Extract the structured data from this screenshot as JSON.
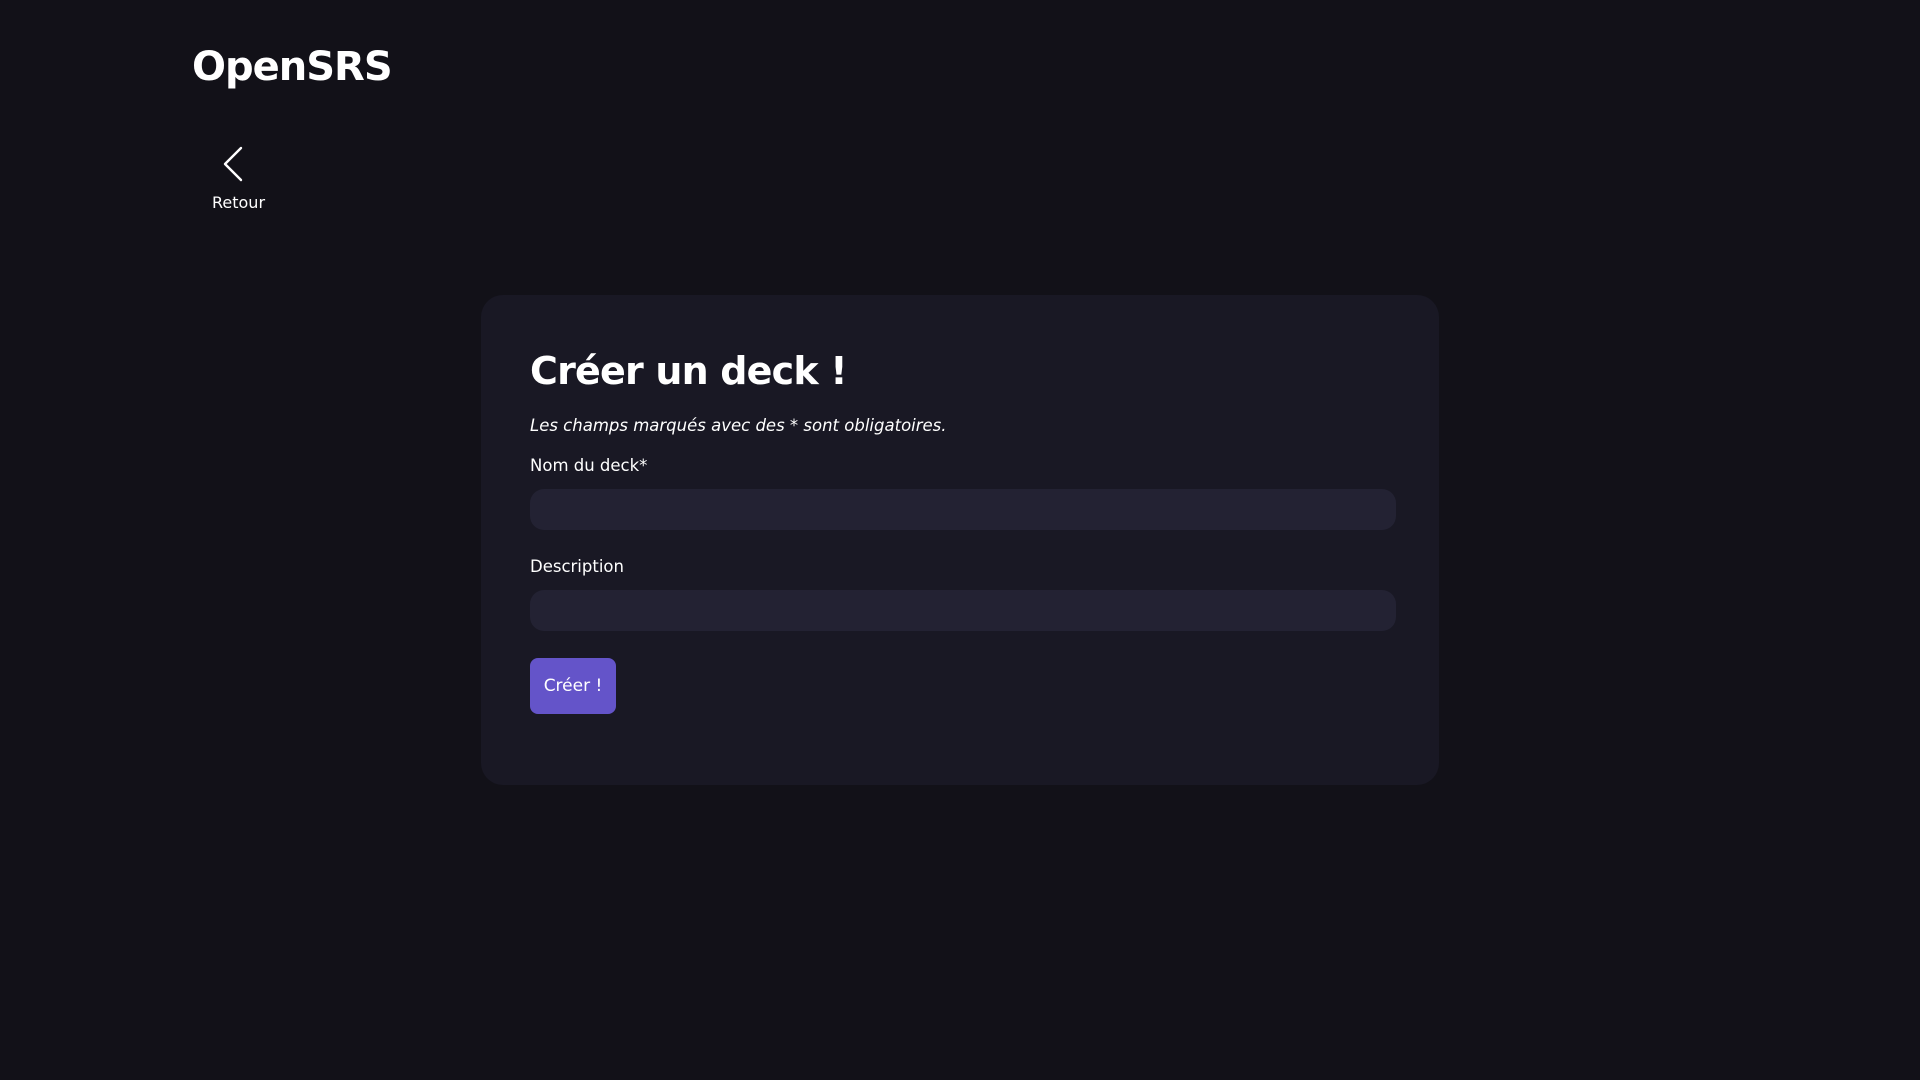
{
  "app": {
    "logo": "OpenSRS"
  },
  "nav": {
    "back_label": "Retour",
    "back_icon": "chevron-left-icon"
  },
  "form": {
    "title": "Créer un deck !",
    "required_note": "Les champs marqués avec des * sont obligatoires.",
    "fields": [
      {
        "label": "Nom du deck*",
        "value": "",
        "placeholder": ""
      },
      {
        "label": "Description",
        "value": "",
        "placeholder": ""
      }
    ],
    "submit_label": "Créer !"
  },
  "colors": {
    "background": "#121118",
    "card": "#191824",
    "input": "#232233",
    "accent": "#6454c9",
    "text": "#ffffff"
  }
}
